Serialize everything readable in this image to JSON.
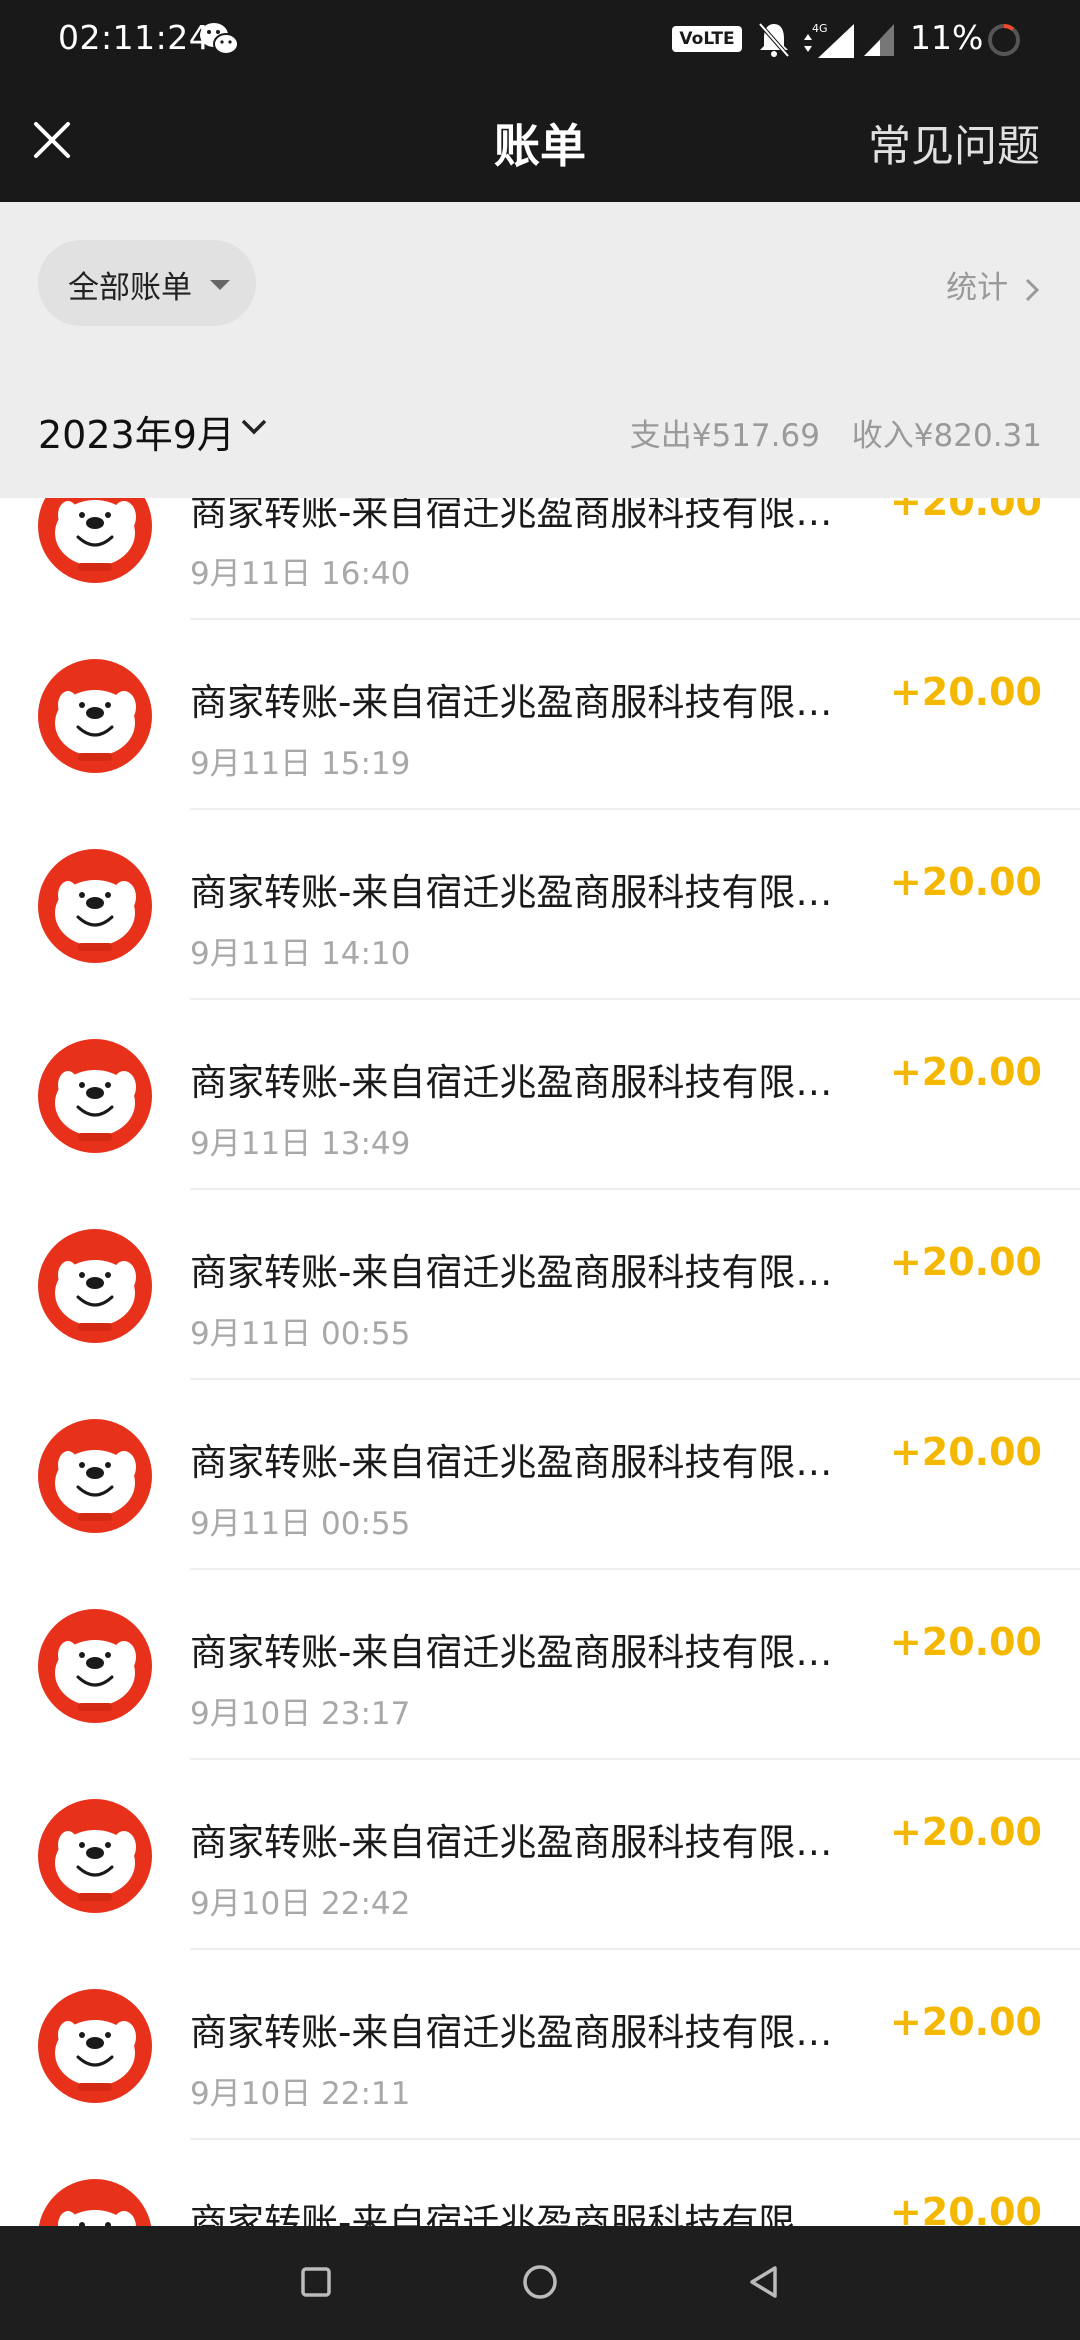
{
  "status_bar": {
    "time": "02:11:24",
    "volte": "VoLTE 1",
    "network": "4G",
    "battery": "11%",
    "icons": [
      "wechat-icon",
      "mute-bell-icon",
      "signal-4g-icon",
      "signal-icon",
      "battery-ring-icon"
    ]
  },
  "header": {
    "title": "账单",
    "faq": "常见问题",
    "close_icon": "close-icon"
  },
  "filter": {
    "selected": "全部账单",
    "stats": "统计"
  },
  "month": {
    "label": "2023年9月",
    "expense": "支出¥517.69",
    "income": "收入¥820.31"
  },
  "transactions": [
    {
      "title": "商家转账-来自宿迁兆盈商服科技有限公司",
      "time": "9月11日 16:40",
      "amount": "+20.00"
    },
    {
      "title": "商家转账-来自宿迁兆盈商服科技有限公司",
      "time": "9月11日 15:19",
      "amount": "+20.00"
    },
    {
      "title": "商家转账-来自宿迁兆盈商服科技有限公司",
      "time": "9月11日 14:10",
      "amount": "+20.00"
    },
    {
      "title": "商家转账-来自宿迁兆盈商服科技有限公司",
      "time": "9月11日 13:49",
      "amount": "+20.00"
    },
    {
      "title": "商家转账-来自宿迁兆盈商服科技有限公司",
      "time": "9月11日 00:55",
      "amount": "+20.00"
    },
    {
      "title": "商家转账-来自宿迁兆盈商服科技有限公司",
      "time": "9月11日 00:55",
      "amount": "+20.00"
    },
    {
      "title": "商家转账-来自宿迁兆盈商服科技有限公司",
      "time": "9月10日 23:17",
      "amount": "+20.00"
    },
    {
      "title": "商家转账-来自宿迁兆盈商服科技有限公司",
      "time": "9月10日 22:42",
      "amount": "+20.00"
    },
    {
      "title": "商家转账-来自宿迁兆盈商服科技有限公司",
      "time": "9月10日 22:11",
      "amount": "+20.00"
    },
    {
      "title": "商家转账-来自宿迁兆盈商服科技有限公司",
      "time": "",
      "amount": "+20.00"
    }
  ],
  "colors": {
    "header_bg": "#191919",
    "filter_bg": "#ededed",
    "amount": "#f5b800",
    "avatar_red": "#e8311a"
  },
  "system_nav": [
    "recents-square-icon",
    "home-circle-icon",
    "back-triangle-icon"
  ]
}
